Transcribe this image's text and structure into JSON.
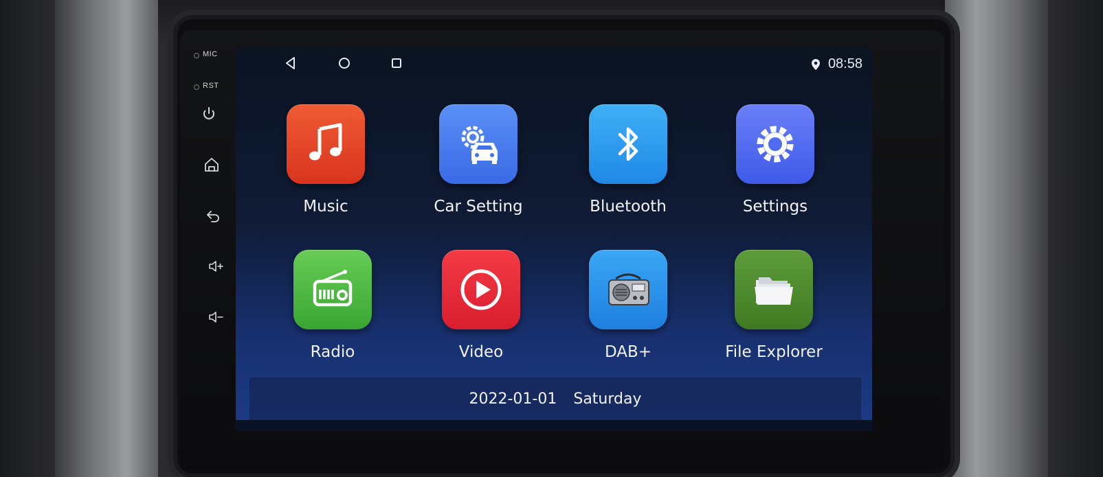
{
  "hardware": {
    "mic_label": "MIC",
    "rst_label": "RST",
    "keys": [
      "power-icon",
      "home-icon",
      "back-icon",
      "volume-up-icon",
      "volume-down-icon"
    ]
  },
  "statusbar": {
    "nav_buttons": [
      "back-triangle-icon",
      "home-circle-icon",
      "recents-square-icon"
    ],
    "location_icon": "location-pin-icon",
    "time": "08:58"
  },
  "apps": [
    {
      "label": "Music",
      "icon": "music-note-icon",
      "color": "#e0432a"
    },
    {
      "label": "Car Setting",
      "icon": "car-gear-icon",
      "color": "#3f7cf0"
    },
    {
      "label": "Bluetooth",
      "icon": "bluetooth-icon",
      "color": "#2b9cf0"
    },
    {
      "label": "Settings",
      "icon": "gear-icon",
      "color": "#4f6cf0"
    },
    {
      "label": "Radio",
      "icon": "radio-icon",
      "color": "#4cb842"
    },
    {
      "label": "Video",
      "icon": "play-icon",
      "color": "#e62a3a"
    },
    {
      "label": "DAB+",
      "icon": "dab-radio-icon",
      "color": "#2b8ee8"
    },
    {
      "label": "File Explorer",
      "icon": "folder-icon",
      "color": "#4f8a2c"
    }
  ],
  "datebar": {
    "date": "2022-01-01",
    "weekday": "Saturday"
  }
}
